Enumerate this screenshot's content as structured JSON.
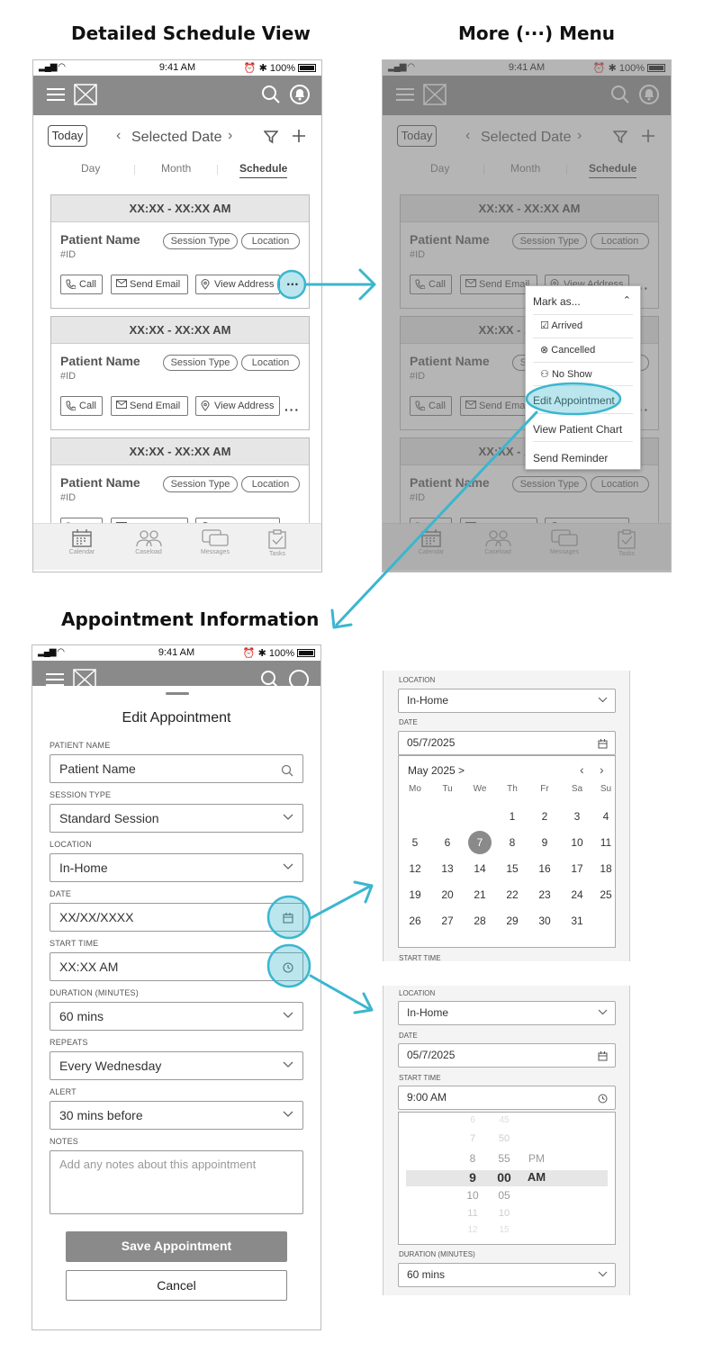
{
  "titles": {
    "schedule": "Detailed Schedule View",
    "menu": "More (···) Menu",
    "appointment": "Appointment Information"
  },
  "status": {
    "time": "9:41 AM",
    "battery": "100%"
  },
  "toolbar": {
    "today": "Today",
    "selected_date": "Selected Date"
  },
  "tabs": [
    "Day",
    "Month",
    "Schedule"
  ],
  "cards": [
    {
      "time": "XX:XX - XX:XX AM",
      "patient": "Patient Name",
      "id": "#ID",
      "session": "Session Type",
      "location": "Location"
    },
    {
      "time": "XX:XX - XX:XX AM",
      "patient": "Patient Name",
      "id": "#ID",
      "session": "Session Type",
      "location": "Location"
    },
    {
      "time": "XX:XX - XX:XX AM",
      "patient": "Patient Name",
      "id": "#ID",
      "session": "Session Type",
      "location": "Location"
    }
  ],
  "actions": {
    "call": "Call",
    "email": "Send Email",
    "address": "View Address"
  },
  "tabbar": [
    "Calendar",
    "Caseload",
    "Messages",
    "Tasks"
  ],
  "menu": {
    "mark_as": "Mark as...",
    "arrived": "Arrived",
    "cancelled": "Cancelled",
    "no_show": "No Show",
    "edit": "Edit Appointment",
    "chart": "View Patient Chart",
    "reminder": "Send Reminder"
  },
  "form": {
    "title": "Edit Appointment",
    "patient_label": "PATIENT NAME",
    "patient_value": "Patient Name",
    "session_label": "SESSION TYPE",
    "session_value": "Standard Session",
    "location_label": "LOCATION",
    "location_value": "In-Home",
    "date_label": "DATE",
    "date_value": "XX/XX/XXXX",
    "start_label": "START TIME",
    "start_value": "XX:XX AM",
    "duration_label": "DURATION (MINUTES)",
    "duration_value": "60 mins",
    "repeats_label": "REPEATS",
    "repeats_value": "Every Wednesday",
    "alert_label": "ALERT",
    "alert_value": "30 mins before",
    "notes_label": "NOTES",
    "notes_placeholder": "Add any notes about this appointment",
    "save": "Save Appointment",
    "cancel": "Cancel"
  },
  "date_panel": {
    "location_label": "LOCATION",
    "location_value": "In-Home",
    "date_label": "DATE",
    "date_value": "05/7/2025",
    "month": "May 2025 >",
    "weekdays": [
      "Mo",
      "Tu",
      "We",
      "Th",
      "Fr",
      "Sa",
      "Su"
    ],
    "days": [
      [
        "",
        "",
        "",
        "1",
        "2",
        "3",
        "4"
      ],
      [
        "5",
        "6",
        "7",
        "8",
        "9",
        "10",
        "11"
      ],
      [
        "12",
        "13",
        "14",
        "15",
        "16",
        "17",
        "18"
      ],
      [
        "19",
        "20",
        "21",
        "22",
        "23",
        "24",
        "25"
      ],
      [
        "26",
        "27",
        "28",
        "29",
        "30",
        "31",
        ""
      ]
    ],
    "selected_day": "7",
    "start_label": "START TIME"
  },
  "time_panel": {
    "location_label": "LOCATION",
    "location_value": "In-Home",
    "date_label": "DATE",
    "date_value": "05/7/2025",
    "start_label": "START TIME",
    "start_value": "9:00 AM",
    "hours": [
      "6",
      "7",
      "8",
      "9",
      "10",
      "11",
      "12"
    ],
    "minutes": [
      "45",
      "50",
      "55",
      "00",
      "05",
      "10",
      "15"
    ],
    "ampm": [
      "PM",
      "AM"
    ],
    "duration_label": "DURATION (MINUTES)",
    "duration_value": "60 mins"
  },
  "colors": {
    "accent": "#3bb6cf",
    "appbar": "#8a8a8a"
  }
}
